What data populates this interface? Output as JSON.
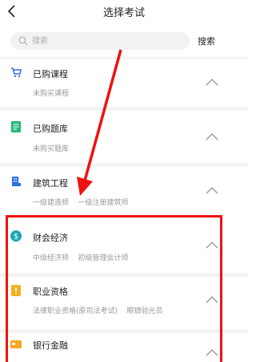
{
  "header": {
    "title": "选择考试"
  },
  "search": {
    "placeholder": "搜索",
    "button_label": "搜索"
  },
  "categories": [
    {
      "name": "已购课程",
      "sub": "未购买课程",
      "icon": "cart-icon",
      "color": "#3f6be8"
    },
    {
      "name": "已购题库",
      "sub": "未购买题库",
      "icon": "question-bank-icon",
      "color": "#22b573"
    },
    {
      "name": "建筑工程",
      "sub": "一级建造师    一级注册建筑师",
      "icon": "building-icon",
      "color": "#2f6fe4"
    },
    {
      "name": "财会经济",
      "sub": "中级经济师    初级管理会计师",
      "icon": "dollar-icon",
      "color": "#1aa7b5"
    },
    {
      "name": "职业资格",
      "sub": "法律职业资格(原司法考试)    眼镜验光员",
      "icon": "badge-icon",
      "color": "#f2b01e"
    },
    {
      "name": "银行金融",
      "sub": "",
      "icon": "bank-card-icon",
      "color": "#f5a623"
    }
  ],
  "annotation": {
    "arrow_color": "#ee1111",
    "box_color": "#ee1111"
  }
}
